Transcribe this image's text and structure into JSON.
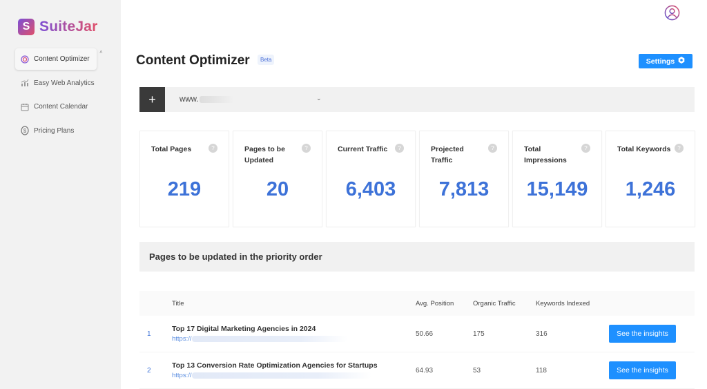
{
  "brand": {
    "name": "SuiteJar",
    "mark": "S"
  },
  "sidebar": {
    "items": [
      {
        "label": "Content Optimizer",
        "icon": "optimizer-icon",
        "active": true
      },
      {
        "label": "Easy Web Analytics",
        "icon": "analytics-icon",
        "active": false
      },
      {
        "label": "Content Calendar",
        "icon": "calendar-icon",
        "active": false
      },
      {
        "label": "Pricing Plans",
        "icon": "dollar-icon",
        "active": false
      }
    ],
    "collapse_glyph": "˄"
  },
  "header": {
    "title": "Content Optimizer",
    "badge": "Beta",
    "settings_label": "Settings"
  },
  "site": {
    "plus_label": "+",
    "domain_prefix": "www.",
    "chevron": "⌄"
  },
  "stats": [
    {
      "label": "Total Pages",
      "value": "219"
    },
    {
      "label": "Pages to be Updated",
      "value": "20"
    },
    {
      "label": "Current Traffic",
      "value": "6,403"
    },
    {
      "label": "Projected Traffic",
      "value": "7,813"
    },
    {
      "label": "Total Impressions",
      "value": "15,149"
    },
    {
      "label": "Total Keywords",
      "value": "1,246"
    }
  ],
  "help_glyph": "?",
  "section": {
    "title": "Pages to be updated in the priority order"
  },
  "table": {
    "columns": [
      "Title",
      "Avg. Position",
      "Organic Traffic",
      "Keywords Indexed"
    ],
    "rows": [
      {
        "index": "1",
        "title": "Top 17 Digital Marketing Agencies in 2024",
        "url_prefix": "https://",
        "avg_position": "50.66",
        "organic_traffic": "175",
        "keywords_indexed": "316",
        "action": "See the insights"
      },
      {
        "index": "2",
        "title": "Top 13 Conversion Rate Optimization Agencies for Startups",
        "url_prefix": "https://",
        "avg_position": "64.93",
        "organic_traffic": "53",
        "keywords_indexed": "118",
        "action": "See the insights"
      }
    ]
  },
  "colors": {
    "accent": "#1e90ff",
    "stat_value": "#3d72d8",
    "brand_start": "#7b4fd6",
    "brand_end": "#e0506a"
  }
}
